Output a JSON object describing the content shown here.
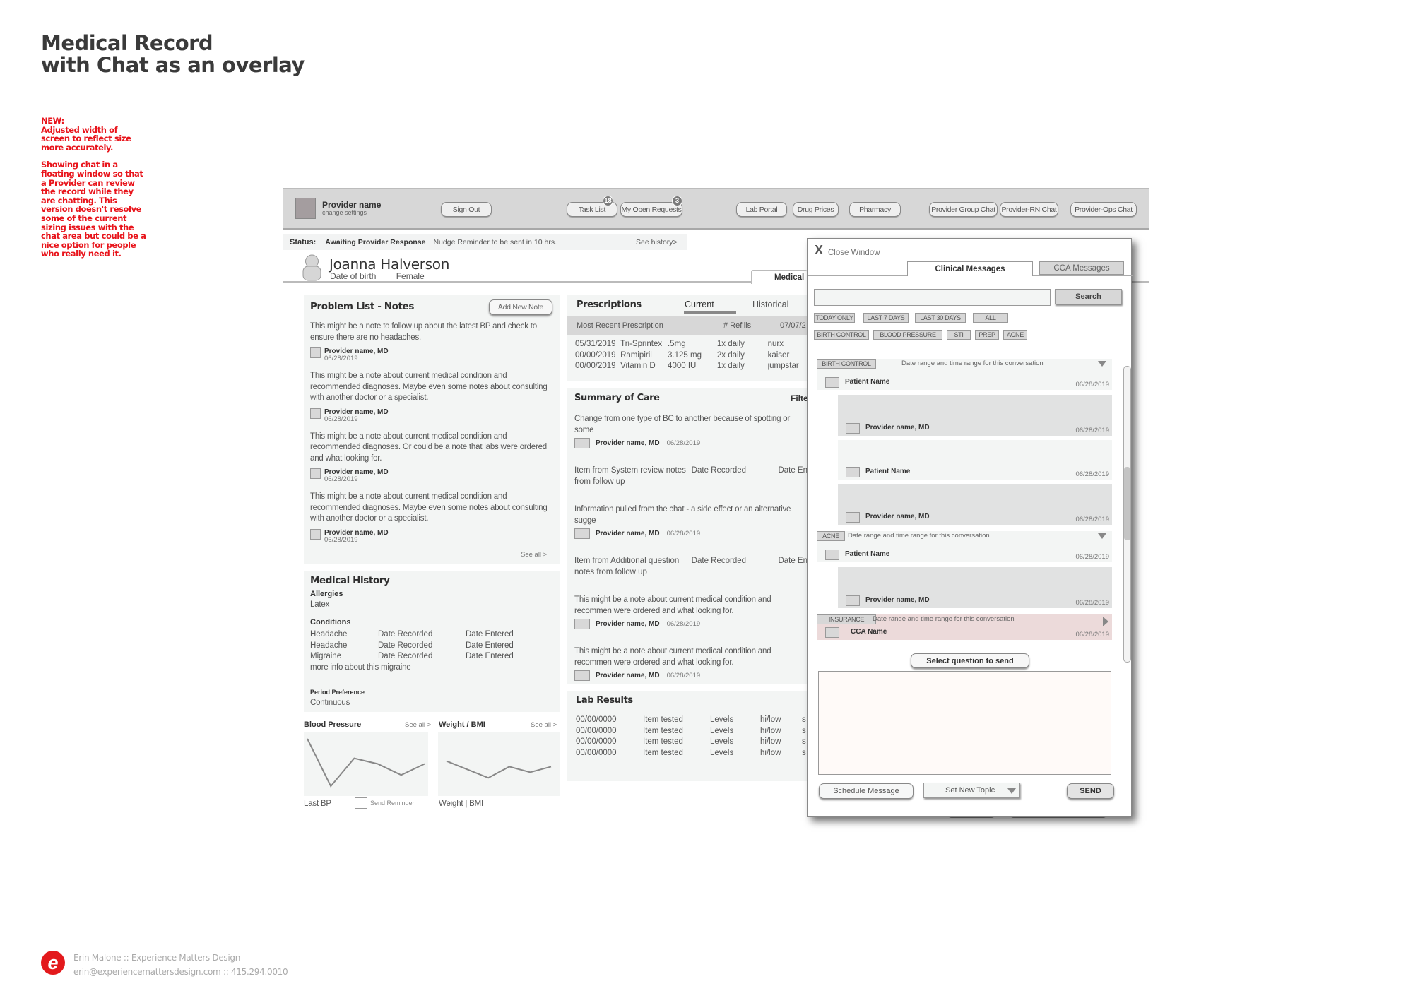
{
  "page": {
    "title_line1": "Medical Record",
    "title_line2": "with Chat as an overlay",
    "notes": [
      "NEW:\nAdjusted width of screen to reflect size more accurately.",
      "Showing chat in a floating window so that a Provider can review the record while they are chatting. This version doesn't resolve some of the current sizing issues with the chat area but could be a nice option for people who really need it."
    ],
    "accent_color": "#e8141b"
  },
  "header": {
    "provider_name": "Provider name",
    "change_settings": "change settings",
    "sign_out": "Sign Out",
    "task_list": "Task List",
    "task_list_badge": "18",
    "open_requests": "My Open Requests",
    "open_requests_badge": "3",
    "lab_portal": "Lab Portal",
    "drug_prices": "Drug Prices",
    "pharmacy": "Pharmacy",
    "provider_group_chat": "Provider Group Chat",
    "provider_rn_chat": "Provider-RN Chat",
    "provider_ops_chat": "Provider-Ops Chat"
  },
  "status": {
    "label": "Status:",
    "value": "Awaiting Provider Response",
    "nudge": "Nudge Reminder to be sent in 10 hrs.",
    "history_link": "See history>"
  },
  "patient": {
    "name": "Joanna Halverson",
    "dob_label": "Date of birth",
    "gender": "Female",
    "active_tab": "Medical"
  },
  "problem_list": {
    "title": "Problem List - Notes",
    "add_button": "Add New Note",
    "notes": [
      {
        "text": "This might be a note to follow up about the latest  BP and check to ensure there are no headaches.",
        "author": "Provider name, MD",
        "date": "06/28/2019"
      },
      {
        "text": "This might be a note about current medical condition and recommended diagnoses. Maybe even some notes about consulting with another doctor or a specialist.",
        "author": "Provider name, MD",
        "date": "06/28/2019"
      },
      {
        "text": "This might be a note about current medical condition and recommended diagnoses. Or could be a note that labs were ordered and what looking for.",
        "author": "Provider name, MD",
        "date": "06/28/2019"
      },
      {
        "text": "This might be a note about current medical condition and recommended diagnoses. Maybe even some notes about consulting with another doctor or a specialist.",
        "author": "Provider name, MD",
        "date": "06/28/2019"
      }
    ],
    "see_all": "See all >"
  },
  "medical_history": {
    "title": "Medical History",
    "allergies_label": "Allergies",
    "allergies_value": "Latex",
    "conditions_label": "Conditions",
    "conditions": [
      {
        "name": "Headache",
        "recorded": "Date Recorded",
        "entered": "Date Entered"
      },
      {
        "name": "Headache",
        "recorded": "Date Recorded",
        "entered": "Date Entered"
      },
      {
        "name": "Migraine",
        "recorded": "Date Recorded",
        "entered": "Date Entered"
      }
    ],
    "more_info": "more info about this migraine",
    "period_label": "Period  Preference",
    "period_value": "Continuous"
  },
  "blood_pressure": {
    "title": "Blood Pressure",
    "see_all": "See all >",
    "footer": "Last BP",
    "send_reminder": "Send Reminder",
    "trend": [
      0.95,
      0.1,
      0.6,
      0.5,
      0.3,
      0.5
    ]
  },
  "weight": {
    "title": "Weight / BMI",
    "see_all": "See all >",
    "footer": "Weight  |  BMI",
    "trend": [
      0.55,
      0.4,
      0.25,
      0.45,
      0.35,
      0.45
    ]
  },
  "prescriptions": {
    "title": "Prescriptions",
    "tab_current": "Current",
    "tab_historical": "Historical",
    "header": {
      "col1": "Most Recent Prescription",
      "col2": "# Refills",
      "col3": "07/07/2"
    },
    "rows": [
      {
        "date": "05/31/2019",
        "drug": "Tri-Sprintex",
        "dose": ".5mg",
        "freq": "1x daily",
        "source": "nurx"
      },
      {
        "date": "00/00/2019",
        "drug": "Ramipiril",
        "dose": "3.125 mg",
        "freq": "2x daily",
        "source": "kaiser"
      },
      {
        "date": "00/00/2019",
        "drug": "Vitamin D",
        "dose": "4000 IU",
        "freq": "1x daily",
        "source": "jumpstar"
      }
    ]
  },
  "summary_of_care": {
    "title": "Summary of Care",
    "filter": "Filte",
    "items": [
      {
        "type": "note",
        "text": "Change from one type of BC to another because of spotting or some",
        "author": "Provider name, MD",
        "date": "06/28/2019"
      },
      {
        "type": "record",
        "text": "Item from System review notes from follow up",
        "recorded": "Date Recorded",
        "entered": "Date En"
      },
      {
        "type": "note",
        "text": "Information pulled from the chat - a side effect or an alternative sugge",
        "author": "Provider name, MD",
        "date": "06/28/2019"
      },
      {
        "type": "record",
        "text": "Item from Additional question notes from follow up",
        "recorded": "Date Recorded",
        "entered": "Date En"
      },
      {
        "type": "note",
        "text": "This might be a note about current medical condition and recommen were ordered and what looking for.",
        "author": "Provider name, MD",
        "date": "06/28/2019"
      },
      {
        "type": "note",
        "text": "This might be a note about current medical condition and recommen were ordered and what looking for.",
        "author": "Provider name, MD",
        "date": "06/28/2019"
      }
    ]
  },
  "lab_results": {
    "title": "Lab Results",
    "rows": [
      {
        "date": "00/00/0000",
        "item": "Item tested",
        "levels": "Levels",
        "range": "hi/low",
        "extra": "s"
      },
      {
        "date": "00/00/0000",
        "item": "Item tested",
        "levels": "Levels",
        "range": "hi/low",
        "extra": "s"
      },
      {
        "date": "00/00/0000",
        "item": "Item tested",
        "levels": "Levels",
        "range": "hi/low",
        "extra": "s"
      },
      {
        "date": "00/00/0000",
        "item": "Item tested",
        "levels": "Levels",
        "range": "hi/low",
        "extra": "s"
      }
    ]
  },
  "chat": {
    "close_icon": "X",
    "close_label": "Close Window",
    "tab_clinical": "Clinical Messages",
    "tab_cca": "CCA Messages",
    "search_placeholder": "",
    "search_button": "Search",
    "date_filters": [
      "TODAY ONLY",
      "LAST 7 DAYS",
      "LAST 30 DAYS",
      "ALL"
    ],
    "topic_filters": [
      "BIRTH CONTROL",
      "BLOOD PRESSURE",
      "STI",
      "PREP",
      "ACNE"
    ],
    "conversations": [
      {
        "topic": "BIRTH CONTROL",
        "range": "Date range and time range for this conversation",
        "expanded": true,
        "messages": [
          {
            "sender": "Patient Name",
            "date": "06/28/2019",
            "style": "light"
          },
          {
            "sender": "Provider name, MD",
            "date": "06/28/2019",
            "style": "grey"
          },
          {
            "sender": "Patient Name",
            "date": "06/28/2019",
            "style": "light"
          },
          {
            "sender": "Provider name, MD",
            "date": "06/28/2019",
            "style": "grey"
          }
        ]
      },
      {
        "topic": "ACNE",
        "range": "Date range and time range for this conversation",
        "expanded": true,
        "messages": [
          {
            "sender": "Patient Name",
            "date": "06/28/2019",
            "style": "light"
          },
          {
            "sender": "Provider name, MD",
            "date": "06/28/2019",
            "style": "grey"
          }
        ]
      },
      {
        "topic": "INSURANCE",
        "range": "Date range and time range for this conversation",
        "expanded": false,
        "messages": [
          {
            "sender": "CCA Name",
            "date": "06/28/2019",
            "style": "pink"
          }
        ]
      }
    ],
    "select_question": "Select question to send",
    "message_value": "",
    "schedule_button": "Schedule Message",
    "topic_select": "Set New Topic",
    "send_button": "SEND",
    "scroll_position": 0.45
  },
  "footer": {
    "line1": "Erin Malone :: Experience Matters Design",
    "line2": "erin@experiencemattersdesign.com :: 415.294.0010",
    "logo_letter": "e"
  }
}
